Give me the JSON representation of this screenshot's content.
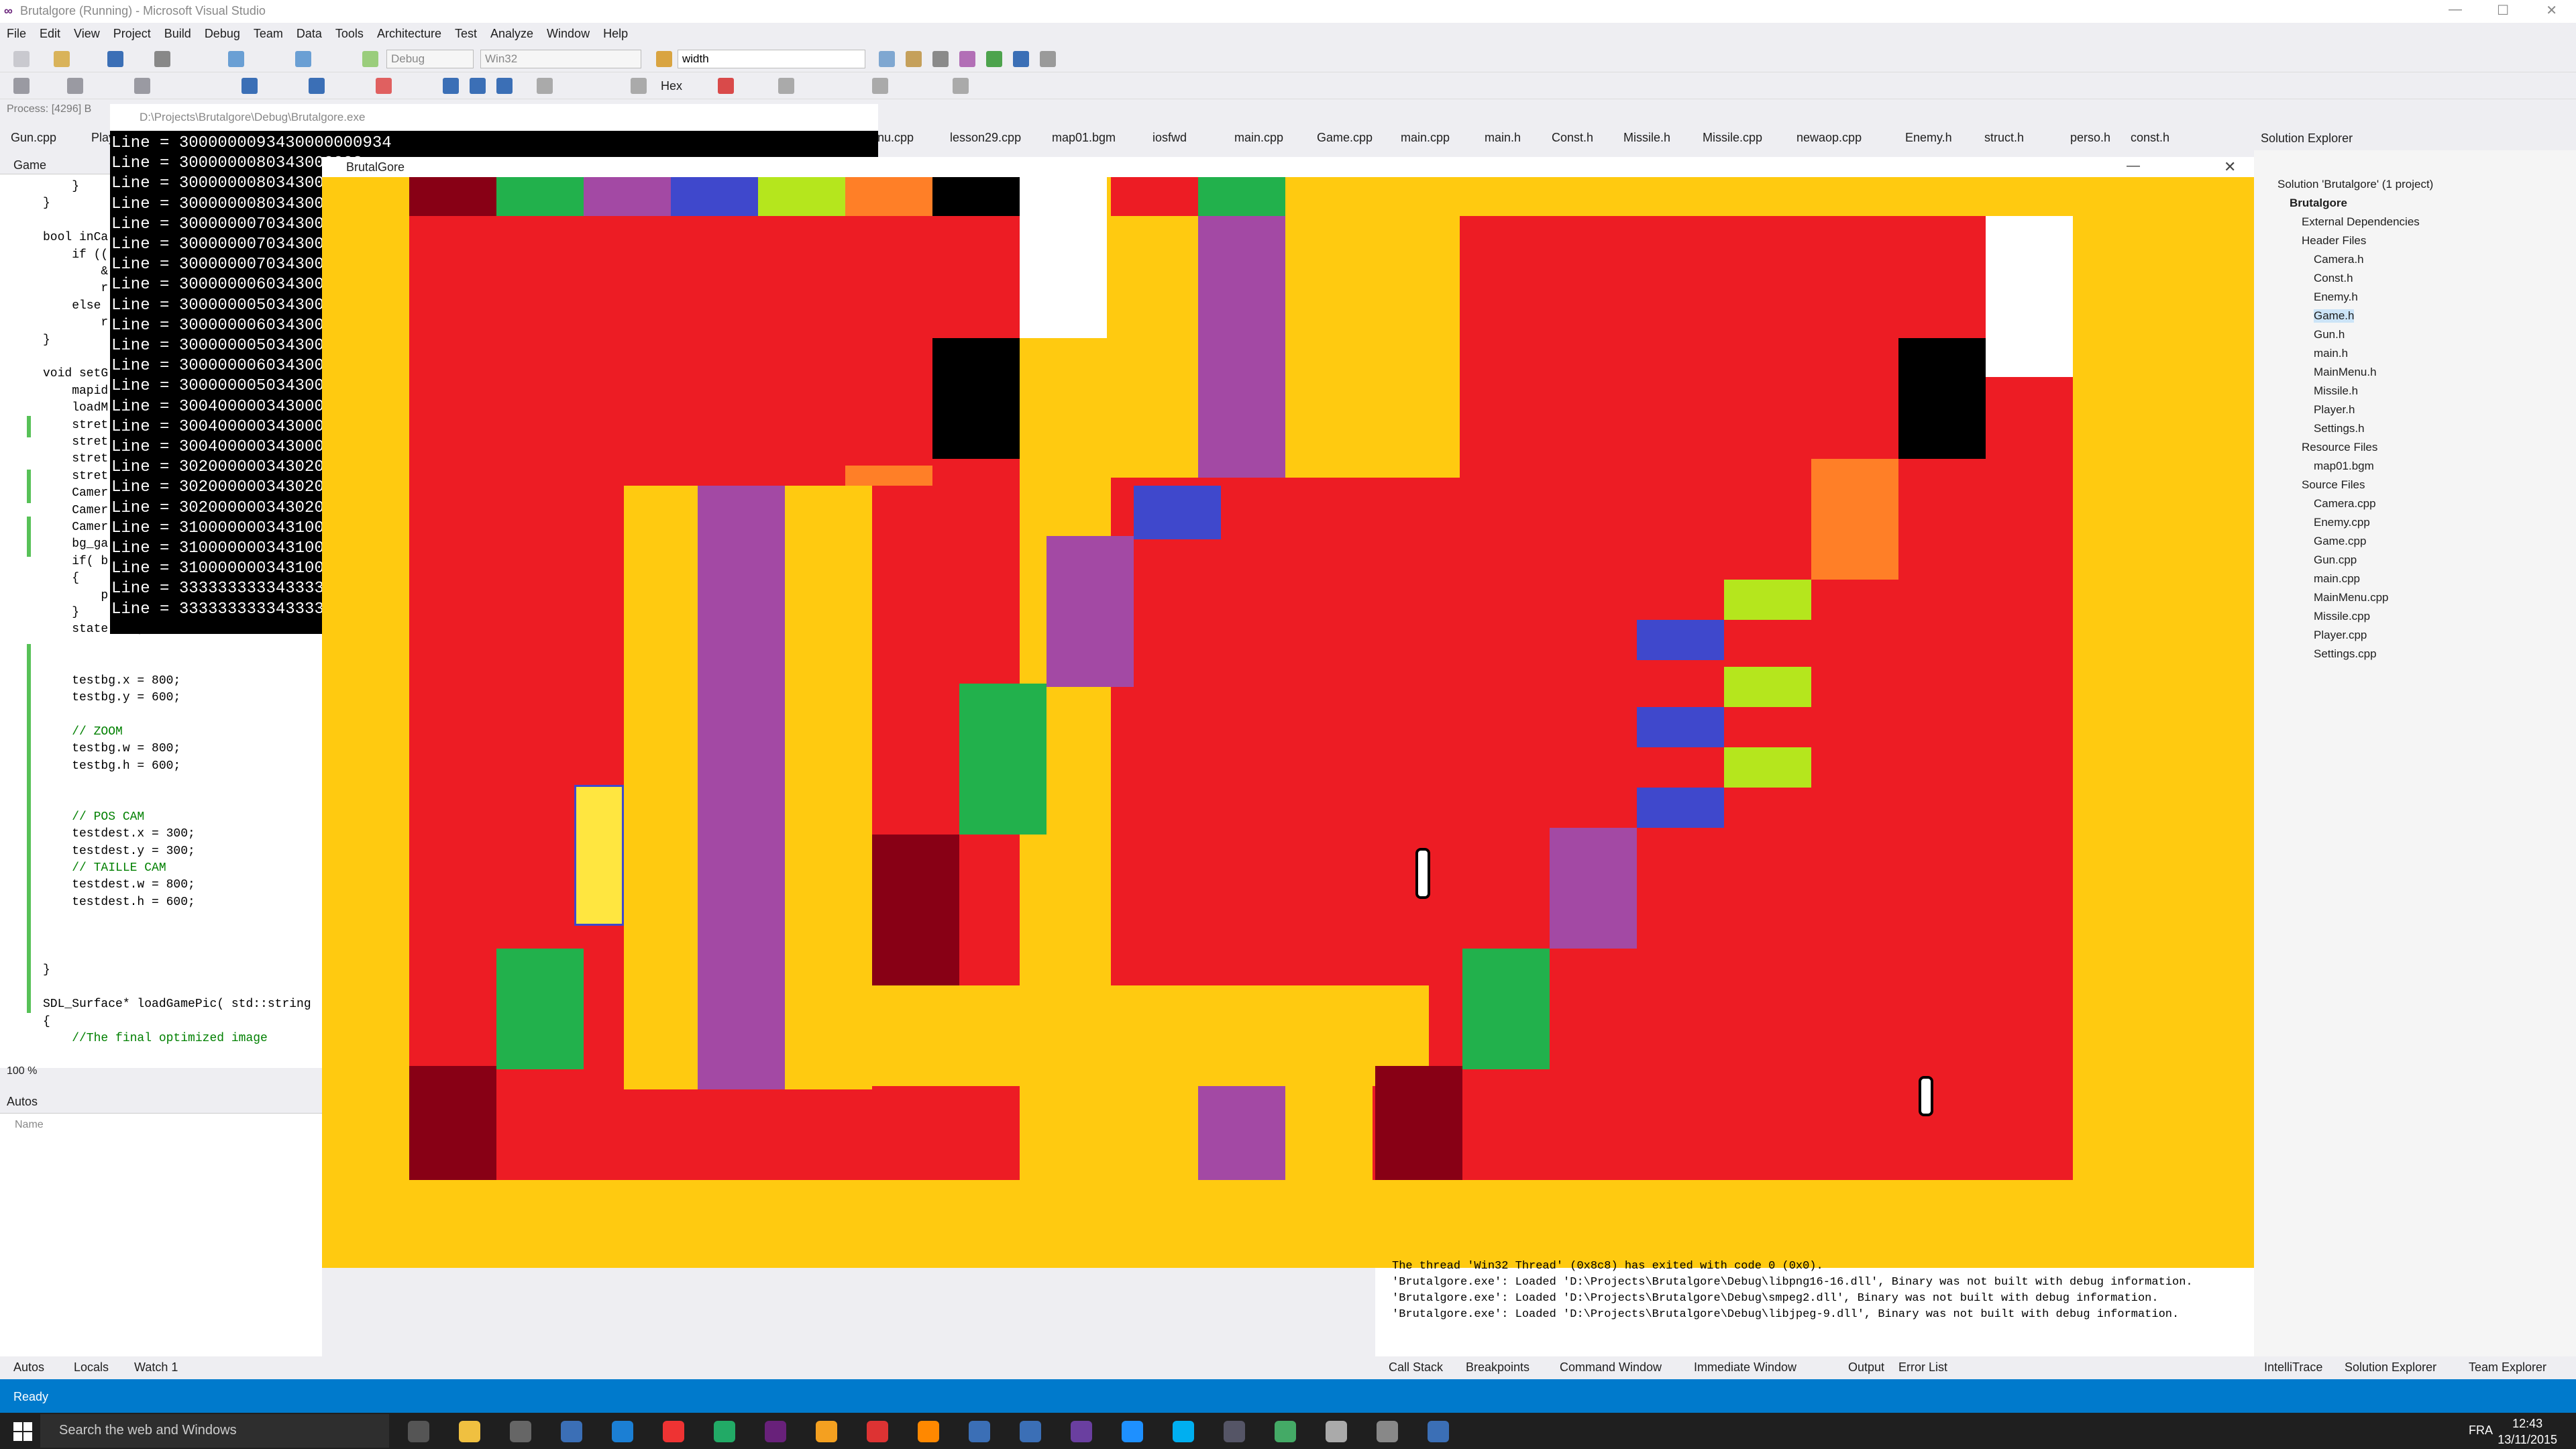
{
  "window": {
    "title": "Brutalgore (Running) - Microsoft Visual Studio"
  },
  "menu": [
    "File",
    "Edit",
    "View",
    "Project",
    "Build",
    "Debug",
    "Team",
    "Data",
    "Tools",
    "Architecture",
    "Test",
    "Analyze",
    "Window",
    "Help"
  ],
  "toolbar": {
    "config": "Debug",
    "platform": "Win32",
    "find": "width",
    "hex": "Hex"
  },
  "process": {
    "label": "Process: [4296] B"
  },
  "doc_tabs": [
    "Gun.cpp",
    "Play",
    "nu.cpp",
    "lesson29.cpp",
    "map01.bgm",
    "iosfwd",
    "main.cpp",
    "Game.cpp",
    "main.cpp",
    "main.h",
    "Const.h",
    "Missile.h",
    "Missile.cpp",
    "newaop.cpp",
    "Enemy.h",
    "struct.h",
    "perso.h",
    "const.h"
  ],
  "editor": {
    "dropdown": "Game",
    "zoom": "100 %",
    "lines": [
      "    }",
      "}",
      "",
      "bool inCa",
      "    if ((",
      "        &",
      "        r",
      "    else",
      "        r",
      "}",
      "",
      "void setG",
      "    mapid",
      "    loadM",
      "    stret",
      "    stret",
      "    stret",
      "    stret",
      "    Camer",
      "    Camer",
      "    Camer",
      "    bg_ga",
      "    if( b",
      "    {",
      "        p",
      "    }",
      "    state = 1;",
      "",
      "",
      "    testbg.x = 800;",
      "    testbg.y = 600;",
      "",
      "    // ZOOM",
      "    testbg.w = 800;",
      "    testbg.h = 600;",
      "",
      "",
      "    // POS CAM",
      "    testdest.x = 300;",
      "    testdest.y = 300;",
      "    // TAILLE CAM",
      "    testdest.w = 800;",
      "    testdest.h = 600;",
      "",
      "",
      "",
      "}",
      "",
      "SDL_Surface* loadGamePic( std::string",
      "{",
      "    //The final optimized image"
    ]
  },
  "console": {
    "title": "D:\\Projects\\Brutalgore\\Debug\\Brutalgore.exe",
    "lines": [
      "Line = 3000000093430000000934",
      "Line = 3000000080343000008",
      "Line = 3000000080343000008",
      "Line = 3000000080343000008",
      "Line = 3000000070343000007",
      "Line = 3000000070343000007",
      "Line = 3000000070343000007",
      "Line = 3000000060343000006",
      "Line = 3000000050343000005",
      "Line = 3000000060343000006",
      "Line = 3000000050343000005",
      "Line = 3000000060343000006",
      "Line = 3000000050343000005",
      "Line = 3004000003430004000",
      "Line = 3004000003430004000",
      "Line = 3004000003430004000",
      "Line = 3020000003430200000",
      "Line = 3020000003430200000",
      "Line = 3020000003430200000",
      "Line = 3100000003431000000",
      "Line = 3100000003431000000",
      "Line = 3100000003431000000",
      "Line = 3333333333433333333",
      "Line = 3333333333433333333"
    ]
  },
  "game": {
    "title": "BrutalGore"
  },
  "solution": {
    "header": "Solution Explorer",
    "items": [
      {
        "label": "Solution 'Brutalgore' (1 project)",
        "level": 0
      },
      {
        "label": "Brutalgore",
        "level": 1,
        "bold": true
      },
      {
        "label": "External Dependencies",
        "level": 2
      },
      {
        "label": "Header Files",
        "level": 2
      },
      {
        "label": "Camera.h",
        "level": 3
      },
      {
        "label": "Const.h",
        "level": 3
      },
      {
        "label": "Enemy.h",
        "level": 3
      },
      {
        "label": "Game.h",
        "level": 3,
        "selected": true
      },
      {
        "label": "Gun.h",
        "level": 3
      },
      {
        "label": "main.h",
        "level": 3
      },
      {
        "label": "MainMenu.h",
        "level": 3
      },
      {
        "label": "Missile.h",
        "level": 3
      },
      {
        "label": "Player.h",
        "level": 3
      },
      {
        "label": "Settings.h",
        "level": 3
      },
      {
        "label": "Resource Files",
        "level": 2
      },
      {
        "label": "map01.bgm",
        "level": 3
      },
      {
        "label": "Source Files",
        "level": 2
      },
      {
        "label": "Camera.cpp",
        "level": 3
      },
      {
        "label": "Enemy.cpp",
        "level": 3
      },
      {
        "label": "Game.cpp",
        "level": 3
      },
      {
        "label": "Gun.cpp",
        "level": 3
      },
      {
        "label": "main.cpp",
        "level": 3
      },
      {
        "label": "MainMenu.cpp",
        "level": 3
      },
      {
        "label": "Missile.cpp",
        "level": 3
      },
      {
        "label": "Player.cpp",
        "level": 3
      },
      {
        "label": "Settings.cpp",
        "level": 3
      }
    ]
  },
  "autos": {
    "header": "Autos",
    "column": "Name"
  },
  "output": {
    "lines": [
      "The thread 'Win32 Thread' (0x8c8) has exited with code 0 (0x0).",
      "'Brutalgore.exe': Loaded 'D:\\Projects\\Brutalgore\\Debug\\libpng16-16.dll', Binary was not built with debug information.",
      "'Brutalgore.exe': Loaded 'D:\\Projects\\Brutalgore\\Debug\\smpeg2.dll', Binary was not built with debug information.",
      "'Brutalgore.exe': Loaded 'D:\\Projects\\Brutalgore\\Debug\\libjpeg-9.dll', Binary was not built with debug information."
    ]
  },
  "bottom_tabs_left": [
    "Autos",
    "Locals",
    "Watch 1"
  ],
  "bottom_tabs_mid": [
    "Call Stack",
    "Breakpoints",
    "Command Window",
    "Immediate Window",
    "Output",
    "Error List"
  ],
  "bottom_tabs_right": [
    "IntelliTrace",
    "Solution Explorer",
    "Team Explorer"
  ],
  "status": "Ready",
  "taskbar": {
    "search": "Search the web and Windows",
    "lang": "FRA",
    "time": "12:43",
    "date": "13/11/2015"
  },
  "colors": {
    "red": "#ed1c24",
    "yellow": "#ffca10",
    "purple": "#a349a4",
    "green": "#22b14c",
    "blue": "#3f48cc",
    "lime": "#b5e61d",
    "orange": "#ff7f27",
    "darkred": "#880015",
    "black": "#000000",
    "white": "#ffffff"
  }
}
